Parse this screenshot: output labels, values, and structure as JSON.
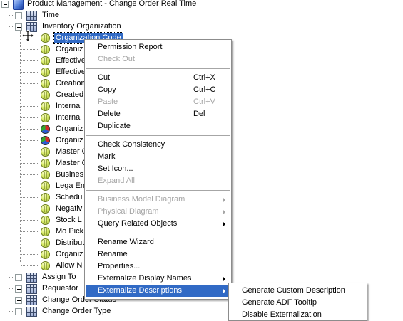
{
  "tree": {
    "root": {
      "label": "Product Management - Change Order Real Time"
    },
    "top_nodes": [
      {
        "label": "Time",
        "expander": "plus"
      },
      {
        "label": "Inventory Organization",
        "expander": "minus"
      }
    ],
    "children": [
      {
        "label": "Organization Code",
        "icon": "ball",
        "selected": true
      },
      {
        "label": "Organiz",
        "icon": "ball"
      },
      {
        "label": "Effective",
        "icon": "ball"
      },
      {
        "label": "Effective",
        "icon": "ball"
      },
      {
        "label": "Creation",
        "icon": "ball"
      },
      {
        "label": "Created",
        "icon": "ball"
      },
      {
        "label": "Internal",
        "icon": "ball"
      },
      {
        "label": "Internal",
        "icon": "ball"
      },
      {
        "label": "Organiz",
        "icon": "ball-multi"
      },
      {
        "label": "Organiz",
        "icon": "ball-multi"
      },
      {
        "label": "Master O",
        "icon": "ball"
      },
      {
        "label": "Master O",
        "icon": "ball"
      },
      {
        "label": "Busines",
        "icon": "ball"
      },
      {
        "label": "Lega En",
        "icon": "ball"
      },
      {
        "label": "Schedul",
        "icon": "ball"
      },
      {
        "label": "Negativ",
        "icon": "ball"
      },
      {
        "label": "Stock L",
        "icon": "ball"
      },
      {
        "label": "Mo Pick",
        "icon": "ball"
      },
      {
        "label": "Distribut",
        "icon": "ball"
      },
      {
        "label": "Organiz",
        "icon": "ball"
      },
      {
        "label": "Allow N",
        "icon": "ball"
      }
    ],
    "bottom_nodes": [
      {
        "label": "Assign To"
      },
      {
        "label": "Requestor"
      },
      {
        "label": "Change Order Status"
      },
      {
        "label": "Change Order Type"
      }
    ]
  },
  "context_menu": {
    "items": [
      {
        "label": "Permission Report",
        "shortcut": "",
        "disabled": false,
        "submenu": false
      },
      {
        "label": "Check Out",
        "shortcut": "",
        "disabled": true,
        "submenu": false
      },
      {
        "sep": true
      },
      {
        "label": "Cut",
        "shortcut": "Ctrl+X",
        "disabled": false,
        "submenu": false
      },
      {
        "label": "Copy",
        "shortcut": "Ctrl+C",
        "disabled": false,
        "submenu": false
      },
      {
        "label": "Paste",
        "shortcut": "Ctrl+V",
        "disabled": true,
        "submenu": false
      },
      {
        "label": "Delete",
        "shortcut": "Del",
        "disabled": false,
        "submenu": false
      },
      {
        "label": "Duplicate",
        "shortcut": "",
        "disabled": false,
        "submenu": false
      },
      {
        "sep": true
      },
      {
        "label": "Check Consistency",
        "shortcut": "",
        "disabled": false,
        "submenu": false
      },
      {
        "label": "Mark",
        "shortcut": "",
        "disabled": false,
        "submenu": false
      },
      {
        "label": "Set Icon...",
        "shortcut": "",
        "disabled": false,
        "submenu": false
      },
      {
        "label": "Expand All",
        "shortcut": "",
        "disabled": true,
        "submenu": false
      },
      {
        "sep": true
      },
      {
        "label": "Business Model Diagram",
        "shortcut": "",
        "disabled": true,
        "submenu": true
      },
      {
        "label": "Physical Diagram",
        "shortcut": "",
        "disabled": true,
        "submenu": true
      },
      {
        "label": "Query Related Objects",
        "shortcut": "",
        "disabled": false,
        "submenu": true
      },
      {
        "sep": true
      },
      {
        "label": "Rename Wizard",
        "shortcut": "",
        "disabled": false,
        "submenu": false
      },
      {
        "label": "Rename",
        "shortcut": "",
        "disabled": false,
        "submenu": false
      },
      {
        "label": "Properties...",
        "shortcut": "",
        "disabled": false,
        "submenu": false
      },
      {
        "label": "Externalize Display Names",
        "shortcut": "",
        "disabled": false,
        "submenu": true
      },
      {
        "label": "Externalize Descriptions",
        "shortcut": "",
        "disabled": false,
        "submenu": true,
        "active": true
      }
    ]
  },
  "submenu": {
    "items": [
      {
        "label": "Generate Custom Description"
      },
      {
        "label": "Generate ADF Tooltip"
      },
      {
        "label": "Disable Externalization"
      }
    ]
  },
  "colors": {
    "selection": "#316ac5",
    "disabled_text": "#a6a6a6"
  }
}
